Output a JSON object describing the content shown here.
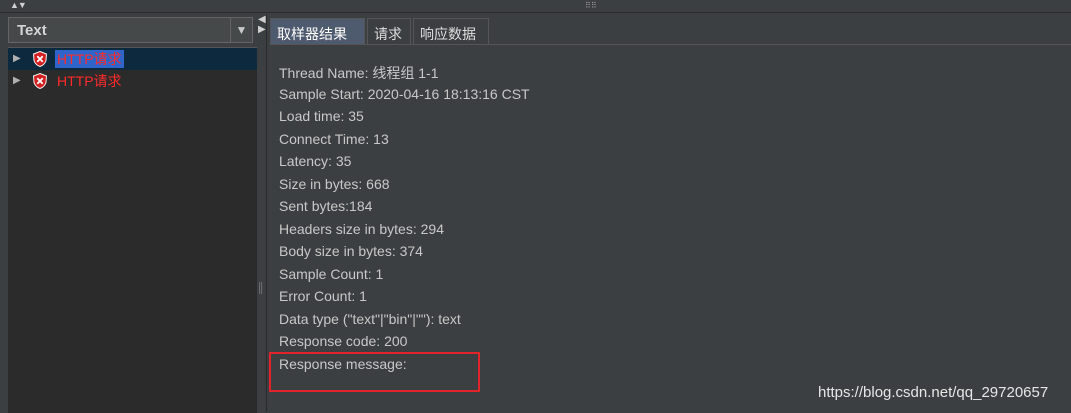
{
  "left": {
    "renderer_combo": {
      "value": "Text",
      "button_icon": "triangle-down-icon"
    },
    "tree": [
      {
        "label": "HTTP请求",
        "status": "error",
        "selected": true,
        "icon": "error-shield-icon"
      },
      {
        "label": "HTTP请求",
        "status": "error",
        "selected": false,
        "icon": "error-shield-icon"
      }
    ]
  },
  "right": {
    "tabs": [
      {
        "label": "取样器结果",
        "active": true
      },
      {
        "label": "请求",
        "active": false
      },
      {
        "label": "响应数据",
        "active": false
      }
    ],
    "result_lines": [
      "Thread Name: 线程组 1-1",
      "Sample Start: 2020-04-16 18:13:16 CST",
      "Load time: 35",
      "Connect Time: 13",
      "Latency: 35",
      "Size in bytes: 668",
      "Sent bytes:184",
      "Headers size in bytes: 294",
      "Body size in bytes: 374",
      "Sample Count: 1",
      "Error Count: 1",
      "Data type (\"text\"|\"bin\"|\"\"): text",
      "Response code: 200",
      "Response message:"
    ]
  },
  "watermark": "https://blog.csdn.net/qq_29720657",
  "colors": {
    "background": "#3c3f41",
    "tree_background": "#2b2b2b",
    "error_label": "#ff2a2a",
    "selection": "#2f65ca",
    "highlight_box": "#e0242a",
    "active_tab": "#4e5a6e"
  }
}
